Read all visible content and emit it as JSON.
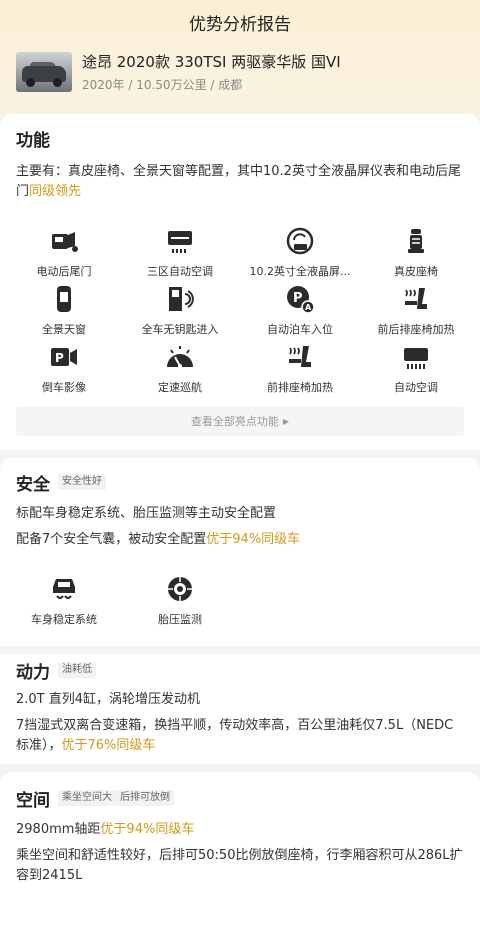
{
  "header": {
    "title": "优势分析报告"
  },
  "car": {
    "name": "途昂 2020款 330TSI 两驱豪华版 国VI",
    "meta": "2020年 / 10.50万公里 / 成都"
  },
  "features_section": {
    "title": "功能",
    "summary_plain": "主要有：真皮座椅、全景天窗等配置，其中10.2英寸全液晶屏仪表和电动后尾门",
    "summary_highlight": "同级领先",
    "items": [
      {
        "label": "电动后尾门",
        "icon": "power-tailgate-icon"
      },
      {
        "label": "三区自动空调",
        "icon": "climate-control-icon"
      },
      {
        "label": "10.2英寸全液晶屏...",
        "icon": "lcd-gauge-icon"
      },
      {
        "label": "真皮座椅",
        "icon": "leather-seat-icon"
      },
      {
        "label": "全景天窗",
        "icon": "sunroof-icon"
      },
      {
        "label": "全车无钥匙进入",
        "icon": "keyless-entry-icon"
      },
      {
        "label": "自动泊车入位",
        "icon": "auto-park-icon"
      },
      {
        "label": "前后排座椅加热",
        "icon": "seat-heating-icon"
      },
      {
        "label": "倒车影像",
        "icon": "reverse-camera-icon"
      },
      {
        "label": "定速巡航",
        "icon": "cruise-control-icon"
      },
      {
        "label": "前排座椅加热",
        "icon": "front-seat-heating-icon"
      },
      {
        "label": "自动空调",
        "icon": "auto-ac-icon"
      }
    ],
    "view_all_label": "查看全部亮点功能"
  },
  "safety_section": {
    "title": "安全",
    "tag": "安全性好",
    "line1": "标配车身稳定系统、胎压监测等主动安全配置",
    "line2_plain": "配备7个安全气囊，被动安全配置",
    "line2_highlight": "优于94%同级车",
    "items": [
      {
        "label": "车身稳定系统",
        "icon": "stability-control-icon"
      },
      {
        "label": "胎压监测",
        "icon": "tire-pressure-icon"
      }
    ]
  },
  "power_section": {
    "title": "动力",
    "tag": "油耗低",
    "line1": "2.0T 直列4缸，涡轮增压发动机",
    "line2_plain": "7挡湿式双离合变速箱，换挡平顺，传动效率高，百公里油耗仅7.5L（NEDC标准），",
    "line2_highlight": "优于76%同级车"
  },
  "space_section": {
    "title": "空间",
    "tags": [
      "乘坐空间大",
      "后排可放倒"
    ],
    "line1_plain": "2980mm轴距",
    "line1_highlight": "优于94%同级车",
    "line2": "乘坐空间和舒适性较好，后排可50:50比例放倒座椅，行李厢容积可从286L扩容到2415L"
  },
  "colors": {
    "highlight": "#d49a12",
    "icon": "#2b2b2b"
  }
}
